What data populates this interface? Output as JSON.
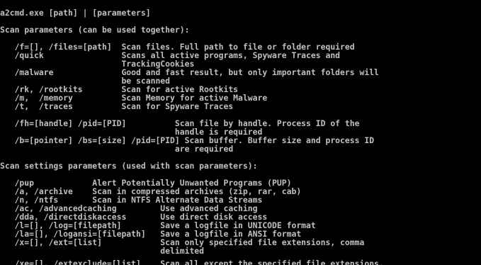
{
  "console": {
    "background_color": "#000000",
    "text_color": "#c0c0c0",
    "lines": [
      "a2cmd.exe [path] | [parameters]",
      "",
      "Scan parameters (can be used together):",
      "",
      "   /f=[], /files=[path]  Scan files. Full path to file or folder required",
      "   /quick                Scans all active programs, Spyware Traces and",
      "                         TrackingCookies",
      "   /malware              Good and fast result, but only important folders will",
      "                         be scanned",
      "   /rk, /rootkits        Scan for active Rootkits",
      "   /m,  /memory          Scan Memory for active Malware",
      "   /t,  /traces          Scan for Spyware Traces",
      "",
      "   /fh=[handle] /pid=[PID]          Scan file by handle. Process ID of the",
      "                                    handle is required",
      "   /b=[pointer] /bs=[size] /pid=[PID] Scan buffer. Buffer size and process ID",
      "                                    are required",
      "",
      "Scan settings parameters (used with scan parameters):",
      "",
      "   /pup            Alert Potentially Unwanted Programs (PUP)",
      "   /a, /archive    Scan in compressed archives (zip, rar, cab)",
      "   /n, /ntfs       Scan in NTFS Alternate Data Streams",
      "   /ac, /advancedcaching         Use advanced caching",
      "   /dda, /directdiskaccess       Use direct disk access",
      "   /l=[], /log=[filepath]        Save a logfile in UNICODE format",
      "   /la=[], /logansi=[filepath]   Save a logfile in ANSI format",
      "   /x=[], /ext=[list]            Scan only specified file extensions, comma",
      "                                 delimited",
      "   /xe=[], /extexclude=[list]    Scan all except the specified file extensions,"
    ]
  }
}
